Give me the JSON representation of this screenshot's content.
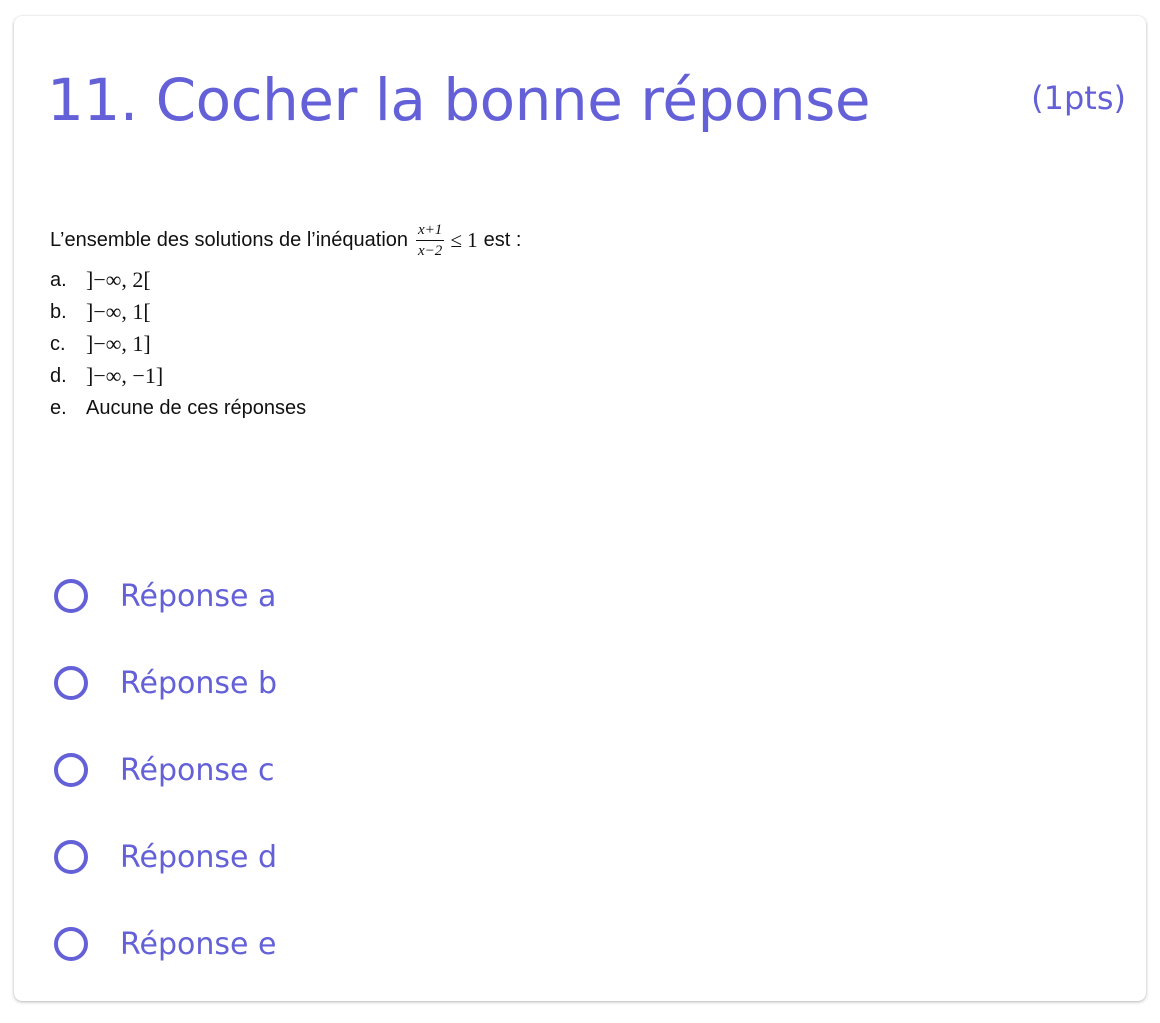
{
  "question": {
    "title": "11. Cocher la bonne réponse",
    "points": "(1pts)",
    "stem_text": "L’ensemble des solutions de l’inéquation",
    "fraction_numerator": "x+1",
    "fraction_denominator": "x−2",
    "relation": "≤ 1",
    "stem_suffix": "est :",
    "options": [
      {
        "letter": "a.",
        "text": "]−∞, 2["
      },
      {
        "letter": "b.",
        "text": "]−∞, 1["
      },
      {
        "letter": "c.",
        "text": "]−∞, 1]"
      },
      {
        "letter": "d.",
        "text": "]−∞, −1]"
      },
      {
        "letter": "e.",
        "text": "Aucune de ces réponses"
      }
    ]
  },
  "answers": [
    {
      "label": "Réponse a",
      "selected": false
    },
    {
      "label": "Réponse b",
      "selected": false
    },
    {
      "label": "Réponse c",
      "selected": false
    },
    {
      "label": "Réponse d",
      "selected": false
    },
    {
      "label": "Réponse e",
      "selected": false
    }
  ],
  "colors": {
    "accent": "#6360d8",
    "text": "#111111",
    "background": "#ffffff"
  },
  "icons": {
    "radio": "radio-unchecked-icon"
  }
}
